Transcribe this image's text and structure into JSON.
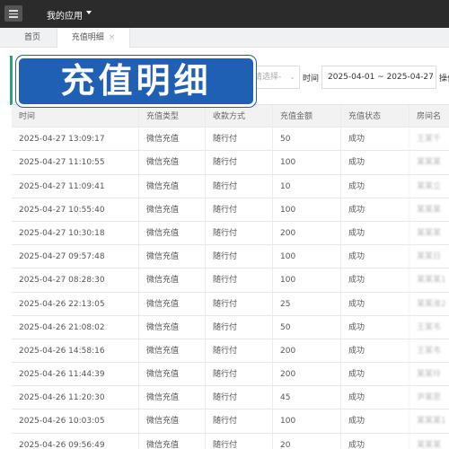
{
  "topbar": {
    "app_title": "我的应用",
    "menu_icon": "hamburger-icon"
  },
  "tabs": [
    {
      "label": "首页"
    },
    {
      "label": "充值明细",
      "close": "×"
    }
  ],
  "overlay_title": "充值明细",
  "filters": {
    "select_placeholder": "请选择-",
    "time_label": "时间",
    "date_range": "2025-04-01 ~ 2025-04-27",
    "op_label": "操作"
  },
  "table": {
    "headers": [
      "时间",
      "充值类型",
      "收款方式",
      "充值金额",
      "充值状态",
      "房间名"
    ],
    "rows": [
      [
        "2025-04-27 13:09:17",
        "微信充值",
        "随行付",
        "50",
        "成功",
        "王某千"
      ],
      [
        "2025-04-27 11:10:55",
        "微信充值",
        "随行付",
        "100",
        "成功",
        "某某某"
      ],
      [
        "2025-04-27 11:09:41",
        "微信充值",
        "随行付",
        "10",
        "成功",
        "某某立"
      ],
      [
        "2025-04-27 10:55:40",
        "微信充值",
        "随行付",
        "100",
        "成功",
        "某某某"
      ],
      [
        "2025-04-27 10:30:18",
        "微信充值",
        "随行付",
        "200",
        "成功",
        "某某某"
      ],
      [
        "2025-04-27 09:57:48",
        "微信充值",
        "随行付",
        "100",
        "成功",
        "某某日"
      ],
      [
        "2025-04-27 08:28:30",
        "微信充值",
        "随行付",
        "100",
        "成功",
        "某某某1"
      ],
      [
        "2025-04-26 22:13:05",
        "微信充值",
        "随行付",
        "25",
        "成功",
        "某某淮2"
      ],
      [
        "2025-04-26 21:08:02",
        "微信充值",
        "随行付",
        "50",
        "成功",
        "王某韦"
      ],
      [
        "2025-04-26 14:58:16",
        "微信充值",
        "随行付",
        "200",
        "成功",
        "王某韦"
      ],
      [
        "2025-04-26 11:44:39",
        "微信充值",
        "随行付",
        "200",
        "成功",
        "某某玲"
      ],
      [
        "2025-04-26 11:20:30",
        "微信充值",
        "随行付",
        "45",
        "成功",
        "尹某思"
      ],
      [
        "2025-04-26 10:03:05",
        "微信充值",
        "随行付",
        "100",
        "成功",
        "某某某1"
      ],
      [
        "2025-04-26 09:56:49",
        "微信充值",
        "随行付",
        "20",
        "成功",
        "某某某"
      ]
    ]
  }
}
